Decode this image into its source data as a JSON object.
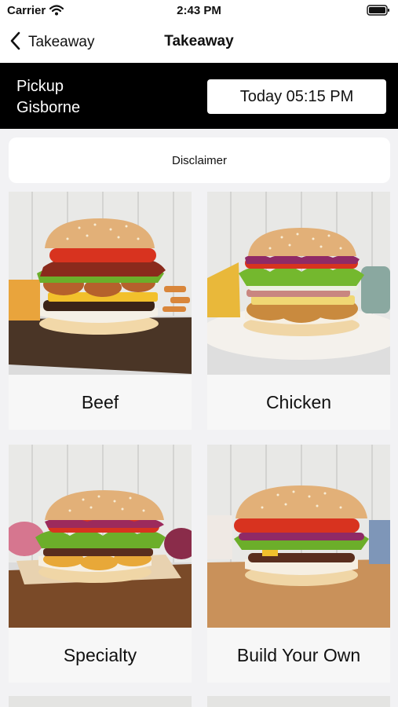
{
  "status": {
    "carrier": "Carrier",
    "time": "2:43 PM"
  },
  "nav": {
    "back_label": "Takeaway",
    "title": "Takeaway"
  },
  "pickup": {
    "line1": "Pickup",
    "line2": "Gisborne",
    "time_label": "Today 05:15 PM"
  },
  "disclaimer_label": "Disclaimer",
  "categories": [
    {
      "label": "Beef"
    },
    {
      "label": "Chicken"
    },
    {
      "label": "Specialty"
    },
    {
      "label": "Build Your Own"
    }
  ],
  "colors": {
    "header_bg": "#000000",
    "page_bg": "#f2f2f4",
    "card_bg": "#f8f8f8"
  },
  "icons": {
    "back": "chevron-left-icon",
    "wifi": "wifi-icon",
    "battery": "battery-icon"
  }
}
